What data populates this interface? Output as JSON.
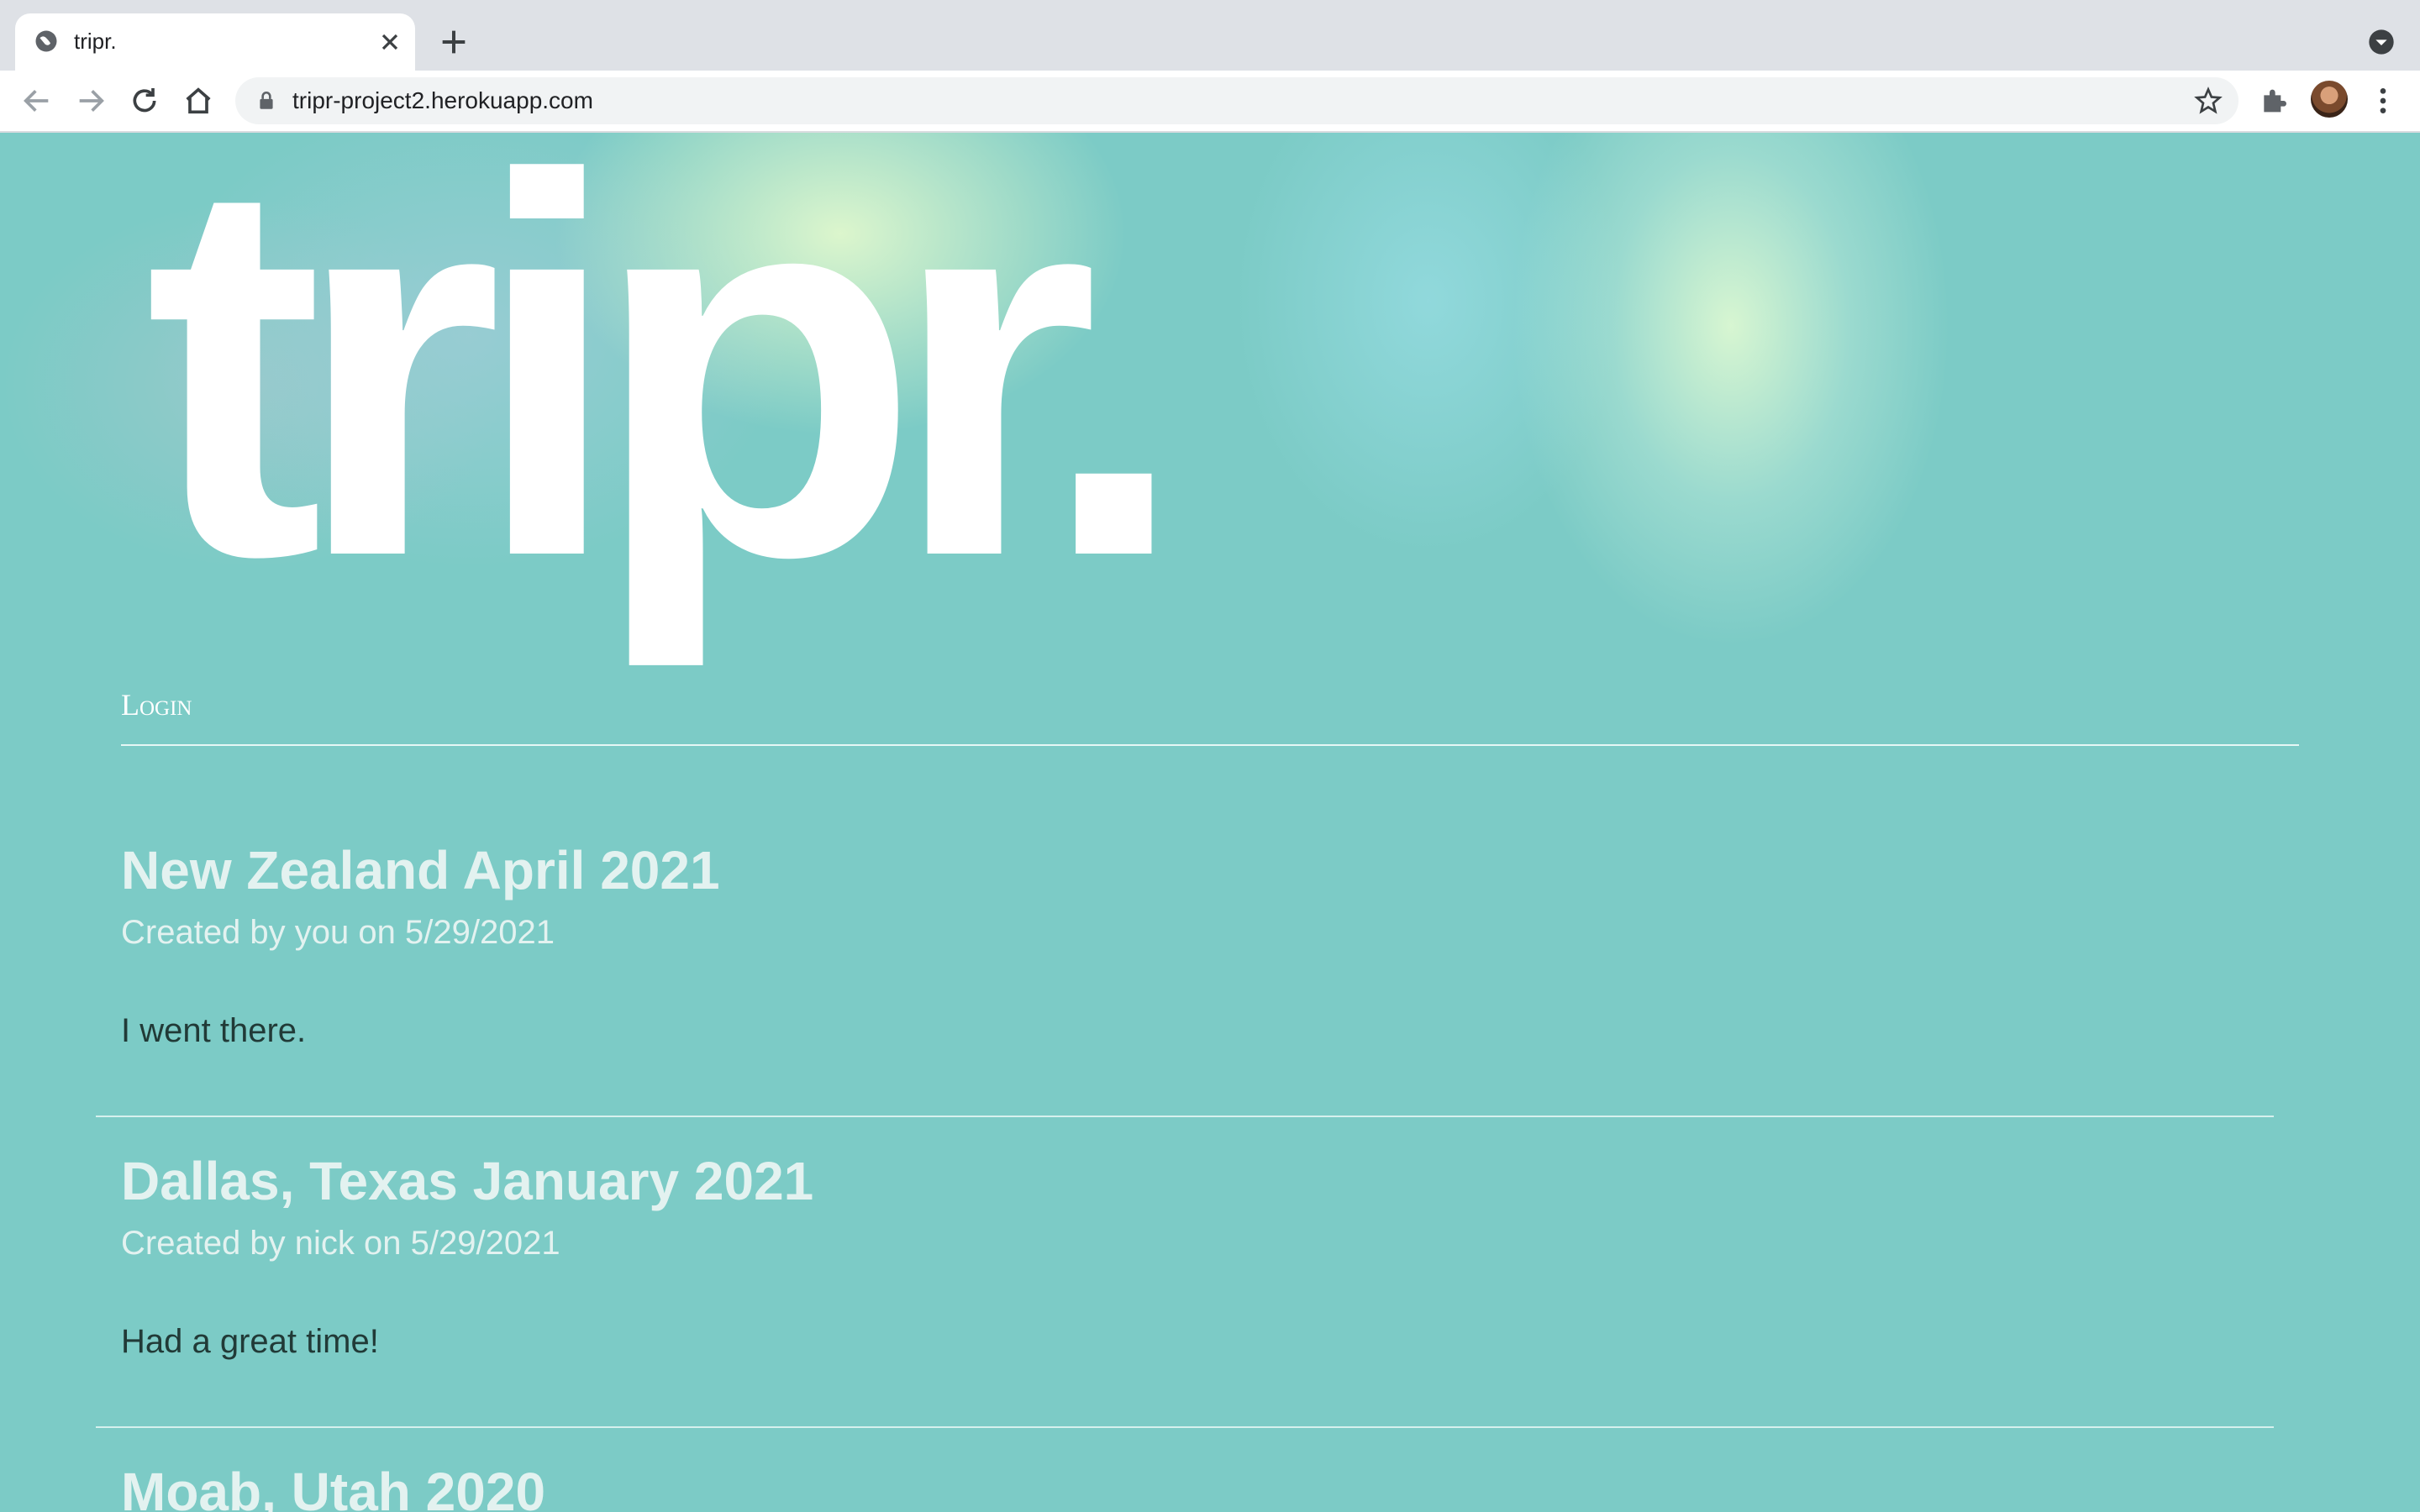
{
  "browser": {
    "tab_title": "tripr.",
    "url": "tripr-project2.herokuapp.com",
    "icons": [
      "globe-icon",
      "close-icon",
      "plus-icon",
      "chevron-down-icon",
      "back-arrow-icon",
      "forward-arrow-icon",
      "reload-icon",
      "home-icon",
      "lock-icon",
      "star-icon",
      "puzzle-icon",
      "avatar",
      "kebab-menu-icon"
    ]
  },
  "site": {
    "logo": "tripr.",
    "nav": {
      "login_label": "Login"
    }
  },
  "trips": [
    {
      "title": "New Zealand April 2021",
      "meta": "Created by you on 5/29/2021",
      "description": "I went there."
    },
    {
      "title": "Dallas, Texas January 2021",
      "meta": "Created by nick on 5/29/2021",
      "description": "Had a great time!"
    },
    {
      "title": "Moab, Utah 2020",
      "meta": "",
      "description": ""
    }
  ],
  "colors": {
    "page_bg": "#7ccbc6",
    "title_text": "#e3f2f0",
    "body_text": "#213a37",
    "logo": "#ffffff"
  }
}
